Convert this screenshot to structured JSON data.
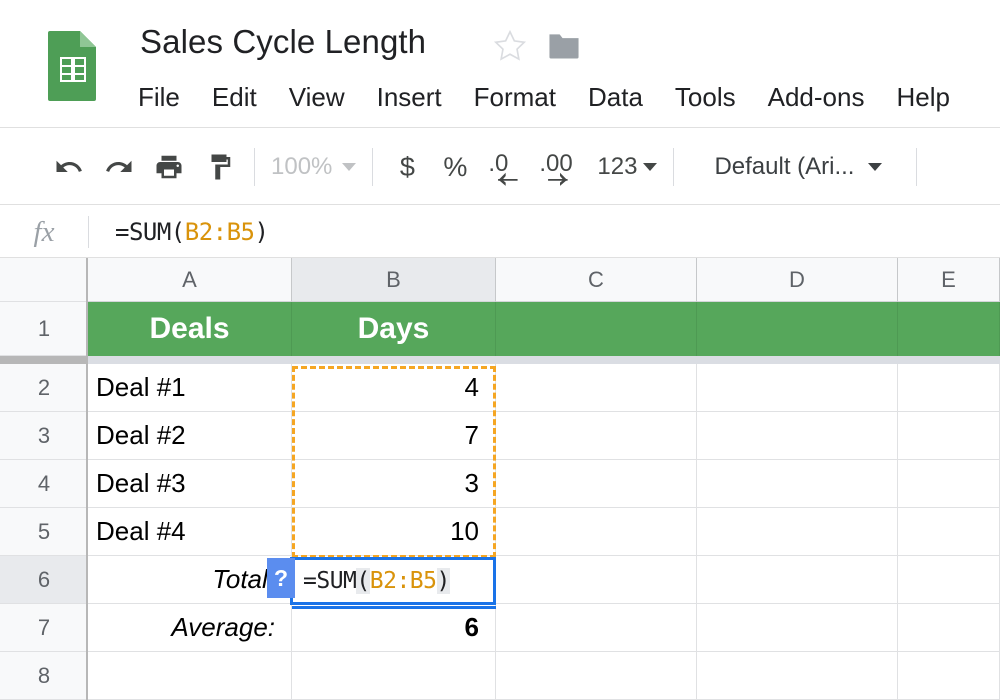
{
  "app": {
    "logo_icon": "google-sheets-icon",
    "doc_title": "Sales Cycle Length",
    "star_icon": "star-outline-icon",
    "folder_icon": "folder-icon",
    "green": "#56a75b",
    "accent_blue": "#1a73e8",
    "ref_orange": "#d9930b",
    "ants_orange": "#f5a623"
  },
  "menubar": {
    "items": [
      {
        "label": "File"
      },
      {
        "label": "Edit"
      },
      {
        "label": "View"
      },
      {
        "label": "Insert"
      },
      {
        "label": "Format"
      },
      {
        "label": "Data"
      },
      {
        "label": "Tools"
      },
      {
        "label": "Add-ons"
      },
      {
        "label": "Help"
      }
    ]
  },
  "toolbar": {
    "undo_icon": "undo-icon",
    "redo_icon": "redo-icon",
    "print_icon": "print-icon",
    "paint_format_icon": "paint-format-icon",
    "zoom_value": "100%",
    "currency_label": "$",
    "percent_label": "%",
    "decrease_decimal_label": ".0",
    "increase_decimal_label": ".00",
    "number_format_label": "123",
    "font_value": "Default (Ari..."
  },
  "formula_bar": {
    "fx_label": "fx",
    "formula_prefix": "=SUM(",
    "formula_ref": "B2:B5",
    "formula_suffix": ")"
  },
  "grid": {
    "columns": [
      {
        "label": "A",
        "active": false
      },
      {
        "label": "B",
        "active": true
      },
      {
        "label": "C",
        "active": false
      },
      {
        "label": "D",
        "active": false
      },
      {
        "label": "E",
        "active": false
      }
    ],
    "rows": [
      {
        "label": "1",
        "active": false
      },
      {
        "label": "2",
        "active": false
      },
      {
        "label": "3",
        "active": false
      },
      {
        "label": "4",
        "active": false
      },
      {
        "label": "5",
        "active": false
      },
      {
        "label": "6",
        "active": true
      },
      {
        "label": "7",
        "active": false
      },
      {
        "label": "8",
        "active": false
      }
    ],
    "header_row": {
      "a": "Deals",
      "b": "Days"
    },
    "data_rows": [
      {
        "row": "2",
        "a": "Deal #1",
        "b": "4"
      },
      {
        "row": "3",
        "a": "Deal #2",
        "b": "7"
      },
      {
        "row": "4",
        "a": "Deal #3",
        "b": "3"
      },
      {
        "row": "5",
        "a": "Deal #4",
        "b": "10"
      }
    ],
    "total_row": {
      "row": "6",
      "a": "Total:",
      "b": ""
    },
    "average_row": {
      "row": "7",
      "a": "Average:",
      "b": "6"
    },
    "empty_row": {
      "row": "8",
      "a": "",
      "b": ""
    }
  },
  "cell_editor": {
    "active_cell": "B6",
    "editing": true,
    "text_prefix": "=SUM",
    "open_paren": "(",
    "text_ref": "B2:B5",
    "close_paren": ")",
    "help_label": "?"
  },
  "selection": {
    "marching_ants_range": "B2:B5"
  }
}
